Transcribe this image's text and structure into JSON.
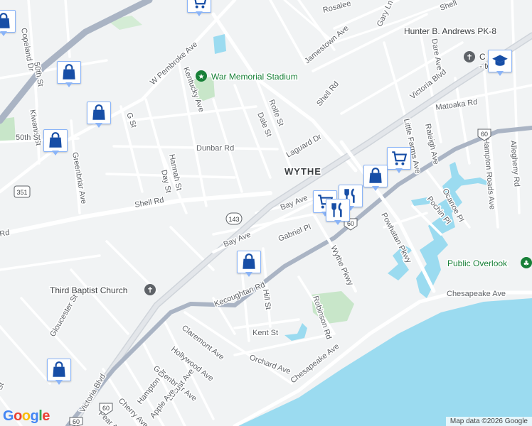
{
  "map": {
    "neighborhood": "WYTHE",
    "streets": {
      "copeland_dr": "Copeland Dr",
      "fiftieth_st_a": "50th St",
      "fiftieth_st_b": "50th St",
      "kiwanis_st": "Kiwanis St",
      "greenbriar_ave_n": "Greenbriar Ave",
      "w_pembroke_ave": "W Pembroke Ave",
      "kentucky_ave": "Kentucky Ave",
      "g_st": "G St",
      "hannah_st": "Hannah St",
      "day_st": "Day St",
      "dunbar_rd": "Dunbar Rd",
      "rolfe_st": "Rolfe St",
      "dale_st": "Dale St",
      "laguard_dr": "Laguard Dr",
      "shell_rd_n": "Shell Rd",
      "shell_rd_w": "Shell Rd",
      "rd_edge": "Rd",
      "victoria_blvd_n": "Victoria Blvd",
      "jamestown_ave": "Jamestown Ave",
      "rosalee": "Rosalee",
      "gary_ln": "Gary Ln",
      "shell_edge": "Shell",
      "dare_ave": "Dare Ave",
      "matoaka_rd": "Matoaka Rd",
      "little_farms_ave": "Little Farms Ave",
      "raleigh_ave": "Raleigh Ave",
      "hampton_roads_ave": "Hampton Roads Ave",
      "allegheny_rd": "Allegheny Rd",
      "bay_ave_a": "Bay Ave",
      "bay_ave_b": "Bay Ave",
      "gabriel_pl": "Gabriel Pl",
      "powhatan_pkwy": "Powhatan Pkwy",
      "pochin_pl": "Pochin Pl",
      "ocanoe_pl": "Ocanoe Pl",
      "wythe_pkwy": "Wythe Pkwy",
      "kecoughtan_rd": "Kecoughtan Rd",
      "hill_st": "Hill St",
      "robinson_rd": "Robinson Rd",
      "kent_st": "Kent St",
      "chesapeake_ave_e": "Chesapeake Ave",
      "chesapeake_ave_s": "Chesapeake Ave",
      "gloucester_st": "Gloucester St",
      "victoria_blvd_s": "Victoria Blvd",
      "claremont_ave": "Claremont Ave",
      "hollywood_ave": "Hollywood Ave",
      "greenbriar_ave_s": "Greenbriar Ave",
      "orchard_ave": "Orchard Ave",
      "hampton_dr": "Hampton Dr",
      "locust_ave": "Locust Ave",
      "cherry_ave": "Cherry Ave",
      "apple_ave": "Apple Ave",
      "pear_ave": "Pear Ave",
      "st_edge": "St"
    },
    "route_shields": {
      "r351": "351",
      "r143": "143",
      "r60_ne": "60",
      "r60_sw": "60",
      "r60_bottom": "60",
      "r60_mid": "60"
    },
    "places": {
      "war_memorial_stadium": "War Memorial Stadium",
      "hunter_b_andrews": "Hunter B. Andrews PK-8",
      "church_partial": "C    Chu",
      "church_partial2": "-    ton",
      "third_baptist_church": "Third Baptist Church",
      "public_overlook": "Public Overlook"
    },
    "pins": [
      {
        "type": "grocery-cart-icon"
      },
      {
        "type": "shopping-bag-icon"
      },
      {
        "type": "shopping-bag-icon"
      },
      {
        "type": "shopping-bag-icon"
      },
      {
        "type": "shopping-bag-icon"
      },
      {
        "type": "grocery-cart-icon"
      },
      {
        "type": "shopping-bag-icon"
      },
      {
        "type": "restaurant-icon"
      },
      {
        "type": "grocery-cart-icon"
      },
      {
        "type": "restaurant-icon"
      },
      {
        "type": "shopping-bag-icon"
      },
      {
        "type": "shopping-bag-icon"
      },
      {
        "type": "school-icon"
      }
    ],
    "colors": {
      "background": "#f1f3f4",
      "water": "#9bdbf0",
      "park": "#c8e6c9",
      "road": "#ffffff",
      "highway": "#aab4c4",
      "pin_border": "#8ab4f8",
      "pin_icon": "#174ea6"
    },
    "attribution": "Map data ©2026 Google",
    "logo": "Google"
  }
}
